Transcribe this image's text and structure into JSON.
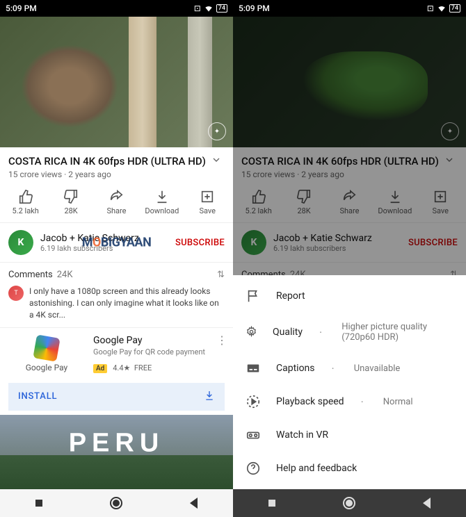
{
  "statusbar": {
    "time": "5:09 PM",
    "battery": "74"
  },
  "video": {
    "title": "COSTA RICA IN 4K 60fps HDR (ULTRA HD)",
    "views": "15 crore views",
    "age": "2 years ago"
  },
  "actions": {
    "like": "5.2 lakh",
    "dislike": "28K",
    "share": "Share",
    "download": "Download",
    "save": "Save"
  },
  "channel": {
    "name": "Jacob + Katie Schwarz",
    "subs": "6.19 lakh subscribers",
    "subscribe": "SUBSCRIBE"
  },
  "watermark": {
    "pre": "M",
    "o": "O",
    "rest": "BIGYAAN"
  },
  "comments": {
    "label": "Comments",
    "count": "24K",
    "top": "I only have a 1080p screen and this already looks astonishing. I can only imagine what it looks like on a 4K scr..."
  },
  "ad": {
    "brand": "Google Pay",
    "title": "Google Pay",
    "desc": "Google Pay for QR code payment",
    "badge": "Ad",
    "rating": "4.4★",
    "price": "FREE",
    "install": "INSTALL"
  },
  "nextvid": {
    "title": "PERU"
  },
  "sheet": {
    "report": "Report",
    "quality": "Quality",
    "quality_val": "Higher picture quality (720p60 HDR)",
    "captions": "Captions",
    "captions_val": "Unavailable",
    "speed": "Playback speed",
    "speed_val": "Normal",
    "vr": "Watch in VR",
    "help": "Help and feedback"
  }
}
